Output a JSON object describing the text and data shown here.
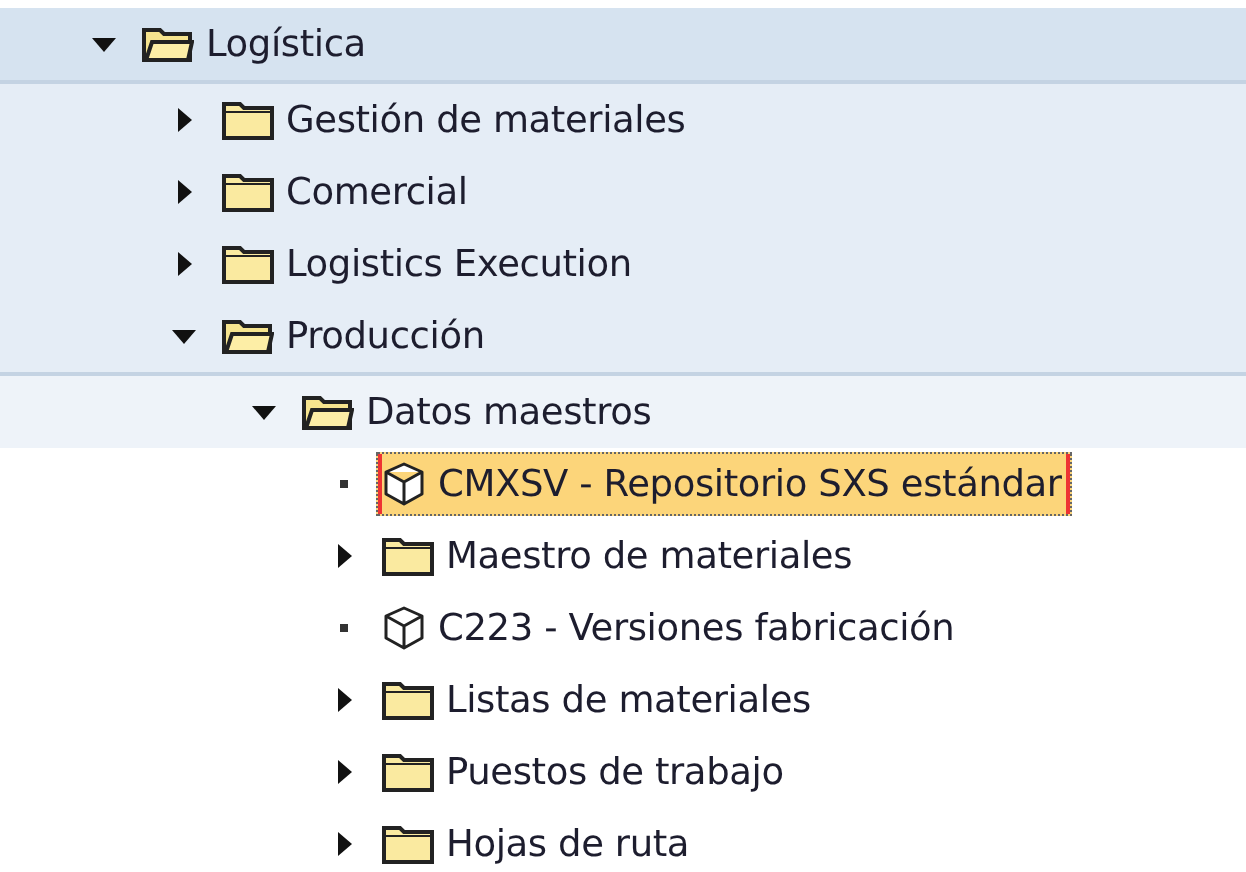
{
  "tree": [
    {
      "kind": "folder",
      "label": "Logística",
      "expanded": true,
      "selected": false,
      "children": [
        {
          "kind": "folder",
          "label": "Gestión de materiales",
          "expanded": false,
          "selected": false
        },
        {
          "kind": "folder",
          "label": "Comercial",
          "expanded": false,
          "selected": false
        },
        {
          "kind": "folder",
          "label": "Logistics Execution",
          "expanded": false,
          "selected": false
        },
        {
          "kind": "folder",
          "label": "Producción",
          "expanded": true,
          "selected": false,
          "children": [
            {
              "kind": "folder",
              "label": "Datos maestros",
              "expanded": true,
              "selected": false,
              "children": [
                {
                  "kind": "transaction",
                  "label": "CMXSV - Repositorio SXS estándar",
                  "selected": true
                },
                {
                  "kind": "folder",
                  "label": "Maestro de materiales",
                  "expanded": false,
                  "selected": false
                },
                {
                  "kind": "transaction",
                  "label": "C223 - Versiones fabricación",
                  "selected": false
                },
                {
                  "kind": "folder",
                  "label": "Listas de materiales",
                  "expanded": false,
                  "selected": false
                },
                {
                  "kind": "folder",
                  "label": "Puestos de trabajo",
                  "expanded": false,
                  "selected": false
                },
                {
                  "kind": "folder",
                  "label": "Hojas de ruta",
                  "expanded": false,
                  "selected": false
                }
              ]
            }
          ]
        }
      ]
    }
  ]
}
